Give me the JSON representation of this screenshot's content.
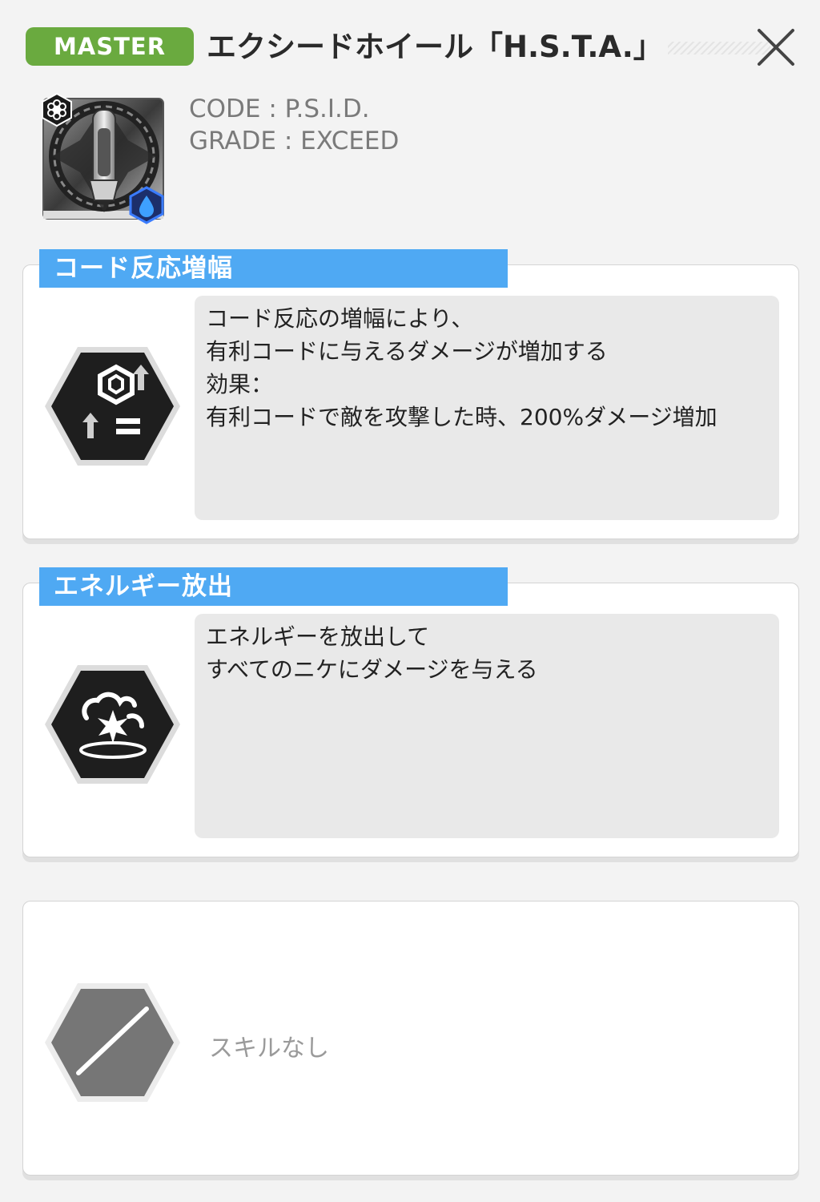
{
  "header": {
    "rank_badge": "MASTER",
    "title": "エクシードホイール「H.S.T.A.」"
  },
  "item": {
    "code_line": "CODE : P.S.I.D.",
    "grade_line": "GRADE : EXCEED",
    "element_icon": "water-drop-icon",
    "class_icon": "flower-hex-icon"
  },
  "skills": [
    {
      "title": "コード反応増幅",
      "icon": "code-boost-icon",
      "lines": [
        "コード反応の増幅により、",
        "有利コードに与えるダメージが増加する",
        "効果：",
        "有利コードで敵を攻撃した時、200%ダメージ増加"
      ]
    },
    {
      "title": "エネルギー放出",
      "icon": "energy-burst-icon",
      "lines": [
        "エネルギーを放出して",
        "すべてのニケにダメージを与える"
      ]
    },
    {
      "title": "",
      "icon": "no-skill-icon",
      "empty_label": "スキルなし"
    }
  ],
  "colors": {
    "badge": "#6aaa3f",
    "tab": "#4fa9f3",
    "hex_dark": "#1e1e1e",
    "hex_disabled": "#767676"
  }
}
